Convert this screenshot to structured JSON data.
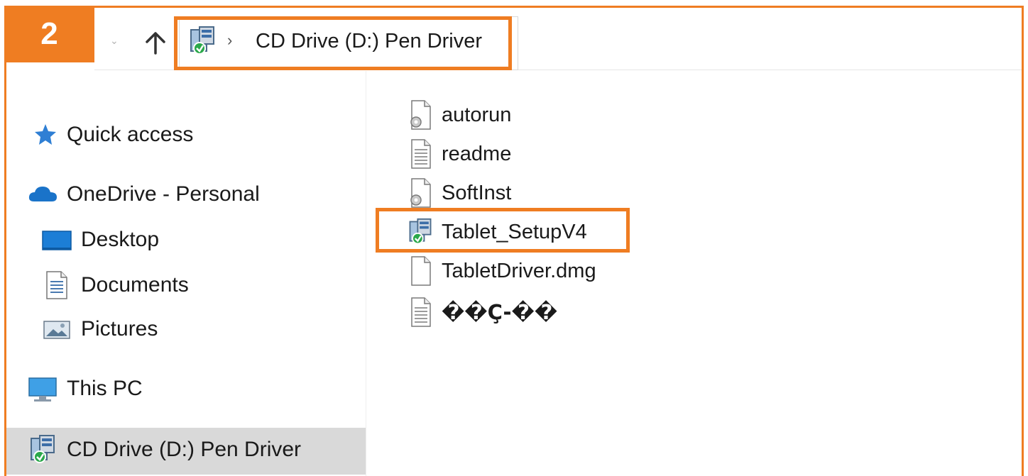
{
  "step": {
    "number": "2"
  },
  "toolbar": {
    "back_icon": "chevron-down-icon",
    "up_icon": "up-arrow-icon",
    "address": {
      "icon": "setup-installer-icon",
      "separator": "›",
      "path": "CD Drive (D:) Pen Driver"
    }
  },
  "sidebar": {
    "items": [
      {
        "label": "Quick access",
        "icon": "star-icon"
      },
      {
        "label": "OneDrive - Personal",
        "icon": "cloud-icon"
      },
      {
        "label": "Desktop",
        "icon": "desktop-icon"
      },
      {
        "label": "Documents",
        "icon": "document-icon"
      },
      {
        "label": "Pictures",
        "icon": "pictures-icon"
      },
      {
        "label": "This PC",
        "icon": "monitor-icon"
      },
      {
        "label": "CD Drive (D:) Pen Driver",
        "icon": "setup-installer-icon",
        "selected": true
      }
    ]
  },
  "files": [
    {
      "name": "autorun",
      "icon": "settings-file-icon"
    },
    {
      "name": "readme",
      "icon": "text-file-icon"
    },
    {
      "name": "SoftInst",
      "icon": "settings-file-icon"
    },
    {
      "name": "Tablet_SetupV4",
      "icon": "setup-installer-icon",
      "highlighted": true
    },
    {
      "name": "TabletDriver.dmg",
      "icon": "blank-file-icon"
    },
    {
      "name": "��Ç-��",
      "icon": "text-file-icon"
    }
  ],
  "colors": {
    "accent": "#ef7d22",
    "selection": "#d9d9d9"
  }
}
